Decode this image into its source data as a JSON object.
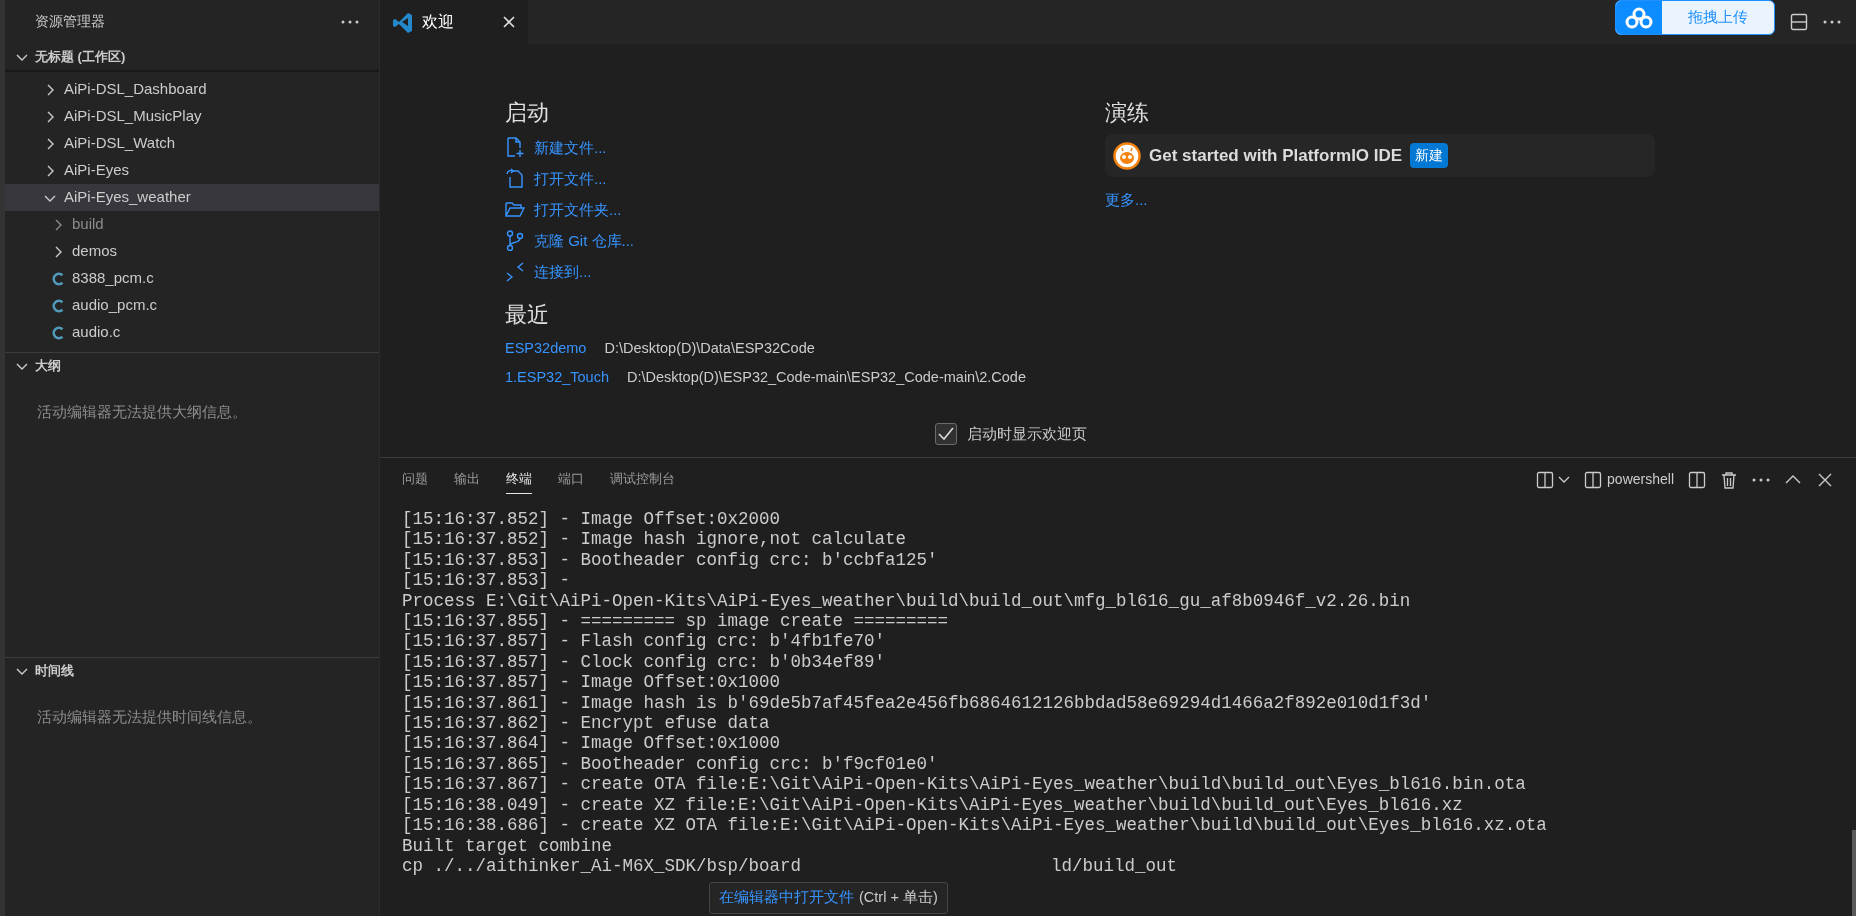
{
  "sidebar": {
    "title": "资源管理器",
    "workspace": {
      "label": "无标题 (工作区)",
      "expanded": true,
      "items": [
        {
          "kind": "folder",
          "label": "AiPi-DSL_Dashboard",
          "expanded": false,
          "selected": false,
          "dimmed": false
        },
        {
          "kind": "folder",
          "label": "AiPi-DSL_MusicPlay",
          "expanded": false,
          "selected": false,
          "dimmed": false
        },
        {
          "kind": "folder",
          "label": "AiPi-DSL_Watch",
          "expanded": false,
          "selected": false,
          "dimmed": false
        },
        {
          "kind": "folder",
          "label": "AiPi-Eyes",
          "expanded": false,
          "selected": false,
          "dimmed": false
        },
        {
          "kind": "folder",
          "label": "AiPi-Eyes_weather",
          "expanded": true,
          "selected": true,
          "dimmed": false,
          "children": [
            {
              "kind": "folder",
              "label": "build",
              "expanded": false,
              "selected": false,
              "dimmed": true
            },
            {
              "kind": "folder",
              "label": "demos",
              "expanded": false,
              "selected": false,
              "dimmed": false
            },
            {
              "kind": "file",
              "label": "8388_pcm.c",
              "selected": false,
              "dimmed": false
            },
            {
              "kind": "file",
              "label": "audio_pcm.c",
              "selected": false,
              "dimmed": false
            },
            {
              "kind": "file",
              "label": "audio.c",
              "selected": false,
              "dimmed": false
            }
          ]
        }
      ]
    },
    "outline": {
      "label": "大纲",
      "expanded": true,
      "message": "活动编辑器无法提供大纲信息。"
    },
    "timeline": {
      "label": "时间线",
      "expanded": true,
      "message": "活动编辑器无法提供时间线信息。"
    }
  },
  "editor": {
    "tabs": [
      {
        "label": "欢迎",
        "selected": true
      }
    ],
    "upload_button": "拖拽上传",
    "welcome": {
      "start": {
        "title": "启动",
        "actions": [
          "新建文件...",
          "打开文件...",
          "打开文件夹...",
          "克隆 Git 仓库...",
          "连接到..."
        ]
      },
      "recent": {
        "title": "最近",
        "items": [
          {
            "name": "ESP32demo",
            "path": "D:\\Desktop(D)\\Data\\ESP32Code"
          },
          {
            "name": "1.ESP32_Touch",
            "path": "D:\\Desktop(D)\\ESP32_Code-main\\ESP32_Code-main\\2.Code"
          }
        ]
      },
      "walkthroughs": {
        "title": "演练",
        "items": [
          {
            "label": "Get started with PlatformIO IDE",
            "badge": "新建"
          }
        ],
        "more": "更多..."
      },
      "show_on_startup": {
        "label": "启动时显示欢迎页",
        "checked": true
      }
    }
  },
  "panel": {
    "tabs": [
      {
        "label": "问题",
        "selected": false
      },
      {
        "label": "输出",
        "selected": false
      },
      {
        "label": "终端",
        "selected": true
      },
      {
        "label": "端口",
        "selected": false
      },
      {
        "label": "调试控制台",
        "selected": false
      }
    ],
    "terminal_name": "powershell",
    "terminal_lines": [
      "[15:16:37.852] - Image Offset:0x2000",
      "[15:16:37.852] - Image hash ignore,not calculate",
      "[15:16:37.853] - Bootheader config crc: b'ccbfa125'",
      "[15:16:37.853] -",
      "Process E:\\Git\\AiPi-Open-Kits\\AiPi-Eyes_weather\\build\\build_out\\mfg_bl616_gu_af8b0946f_v2.26.bin",
      "[15:16:37.855] - ========= sp image create =========",
      "[15:16:37.857] - Flash config crc: b'4fb1fe70'",
      "[15:16:37.857] - Clock config crc: b'0b34ef89'",
      "[15:16:37.857] - Image Offset:0x1000",
      "[15:16:37.861] - Image hash is b'69de5b7af45fea2e456fb6864612126bbdad58e69294d1466a2f892e010d1f3d'",
      "[15:16:37.862] - Encrypt efuse data",
      "[15:16:37.864] - Image Offset:0x1000",
      "[15:16:37.865] - Bootheader config crc: b'f9cf01e0'",
      "[15:16:37.867] - create OTA file:E:\\Git\\AiPi-Open-Kits\\AiPi-Eyes_weather\\build\\build_out\\Eyes_bl616.bin.ota",
      "[15:16:38.049] - create XZ file:E:\\Git\\AiPi-Open-Kits\\AiPi-Eyes_weather\\build\\build_out\\Eyes_bl616.xz",
      "[15:16:38.686] - create XZ OTA file:E:\\Git\\AiPi-Open-Kits\\AiPi-Eyes_weather\\build\\build_out\\Eyes_bl616.xz.ota",
      "Built target combine"
    ],
    "last_line_parts": [
      "cp ./../aithinker_Ai-M6X_SDK/bsp/board",
      "ld/build_out"
    ],
    "tooltip": {
      "link": "在编辑器中打开文件",
      "hint": "(Ctrl + 单击)"
    }
  }
}
